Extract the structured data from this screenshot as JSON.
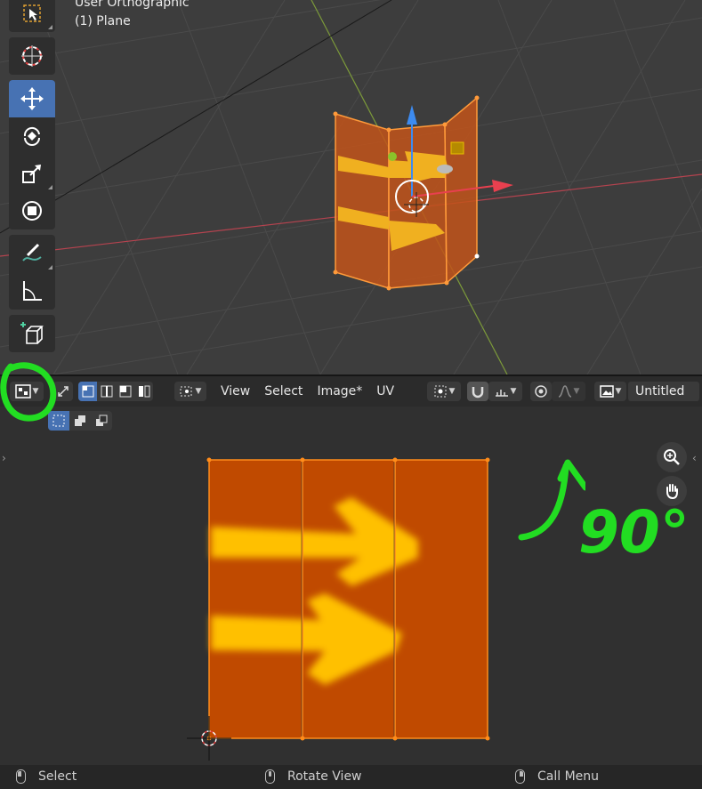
{
  "viewport": {
    "view_label": "User Orthographic",
    "object_label": "(1) Plane"
  },
  "toolbar": {
    "tools": [
      {
        "name": "select-box",
        "active": false
      },
      {
        "name": "cursor",
        "active": false
      },
      {
        "name": "move",
        "active": true
      },
      {
        "name": "rotate",
        "active": false
      },
      {
        "name": "scale",
        "active": false
      },
      {
        "name": "transform",
        "active": false
      },
      {
        "name": "annotate",
        "active": false
      },
      {
        "name": "measure",
        "active": false
      },
      {
        "name": "add-cube",
        "active": false
      }
    ]
  },
  "uv_editor": {
    "menus": [
      "View",
      "Select",
      "Image*",
      "UV"
    ],
    "image_name": "Untitled"
  },
  "annotation": {
    "rotation_text": "90°",
    "color": "#22dd22"
  },
  "statusbar": {
    "items": [
      "Select",
      "Rotate View",
      "Call Menu"
    ]
  },
  "colors": {
    "accent_active": "#4772b3",
    "uv_face": "#c04a00",
    "arrow": "#ffc000",
    "annotation_green": "#22dd22"
  }
}
